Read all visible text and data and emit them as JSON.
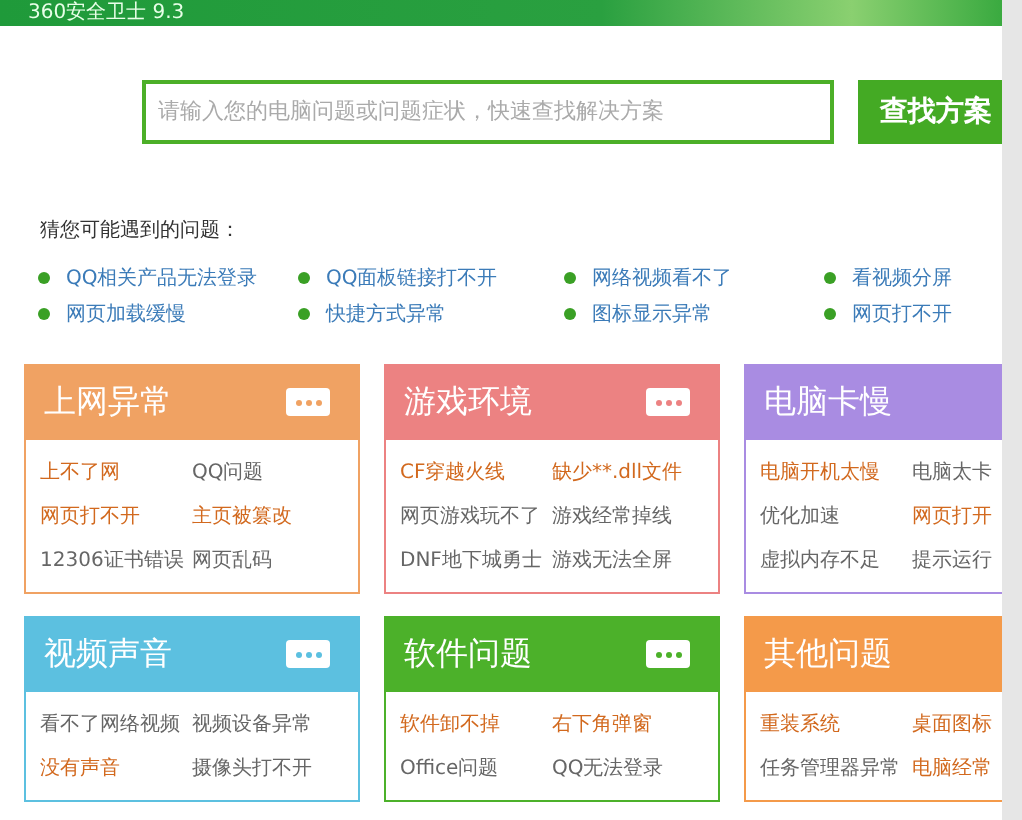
{
  "window": {
    "title": "360安全卫士 9.3"
  },
  "search": {
    "placeholder": "请输入您的电脑问题或问题症状，快速查找解决方案",
    "button": "查找方案"
  },
  "suggestions": {
    "heading": "猜您可能遇到的问题：",
    "items": [
      "QQ相关产品无法登录",
      "QQ面板链接打不开",
      "网络视频看不了",
      "看视频分屏",
      "网页加载缓慢",
      "快捷方式异常",
      "图标显示异常",
      "网页打不开"
    ]
  },
  "categories": [
    {
      "title": "上网异常",
      "color": "#f0a263",
      "more_button": true,
      "links": [
        {
          "text": "上不了网",
          "hot": true
        },
        {
          "text": "QQ问题",
          "hot": false
        },
        {
          "text": "网页打不开",
          "hot": true
        },
        {
          "text": "主页被篡改",
          "hot": true
        },
        {
          "text": "12306证书错误",
          "hot": false
        },
        {
          "text": "网页乱码",
          "hot": false
        }
      ]
    },
    {
      "title": "游戏环境",
      "color": "#ec8282",
      "more_button": true,
      "links": [
        {
          "text": "CF穿越火线",
          "hot": true
        },
        {
          "text": "缺少**.dll文件",
          "hot": true
        },
        {
          "text": "网页游戏玩不了",
          "hot": false
        },
        {
          "text": "游戏经常掉线",
          "hot": false
        },
        {
          "text": "DNF地下城勇士",
          "hot": false
        },
        {
          "text": "游戏无法全屏",
          "hot": false
        }
      ]
    },
    {
      "title": "电脑卡慢",
      "color": "#a98ce2",
      "links": [
        {
          "text": "电脑开机太慢",
          "hot": true
        },
        {
          "text": "电脑太卡",
          "hot": false
        },
        {
          "text": "优化加速",
          "hot": false
        },
        {
          "text": "网页打开",
          "hot": true
        },
        {
          "text": "虚拟内存不足",
          "hot": false
        },
        {
          "text": "提示运行",
          "hot": false
        }
      ]
    },
    {
      "title": "视频声音",
      "color": "#5cc0e0",
      "more_button": true,
      "links": [
        {
          "text": "看不了网络视频",
          "hot": false
        },
        {
          "text": "视频设备异常",
          "hot": false
        },
        {
          "text": "没有声音",
          "hot": true
        },
        {
          "text": "摄像头打不开",
          "hot": false
        }
      ]
    },
    {
      "title": "软件问题",
      "color": "#4cb12a",
      "more_button": true,
      "links": [
        {
          "text": "软件卸不掉",
          "hot": true
        },
        {
          "text": "右下角弹窗",
          "hot": true
        },
        {
          "text": "Office问题",
          "hot": false
        },
        {
          "text": "QQ无法登录",
          "hot": false
        }
      ]
    },
    {
      "title": "其他问题",
      "color": "#f49a4a",
      "links": [
        {
          "text": "重装系统",
          "hot": true
        },
        {
          "text": "桌面图标",
          "hot": true
        },
        {
          "text": "任务管理器异常",
          "hot": false
        },
        {
          "text": "电脑经常",
          "hot": true
        }
      ]
    }
  ]
}
